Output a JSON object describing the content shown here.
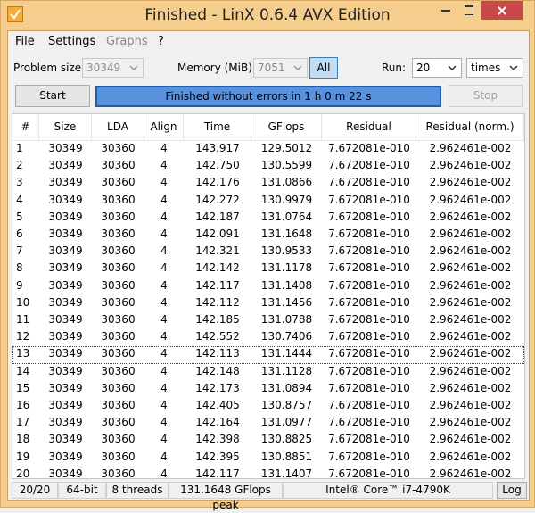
{
  "window": {
    "title": "Finished - LinX 0.6.4 AVX Edition",
    "icon": "checkmark-icon"
  },
  "menu": [
    "File",
    "Settings",
    "Graphs",
    "?"
  ],
  "controls": {
    "problem_size_label": "Problem size:",
    "problem_size_value": "30349",
    "memory_label": "Memory (MiB):",
    "memory_value": "7051",
    "all_label": "All",
    "run_label": "Run:",
    "run_value": "20",
    "times_value": "times",
    "start_label": "Start",
    "stop_label": "Stop",
    "status_text": "Finished without errors in 1 h 0 m 22 s",
    "progress": 1.0
  },
  "table": {
    "columns": [
      "#",
      "Size",
      "LDA",
      "Align",
      "Time",
      "GFlops",
      "Residual",
      "Residual (norm.)"
    ],
    "rows": [
      [
        "1",
        "30349",
        "30360",
        "4",
        "143.917",
        "129.5012",
        "7.672081e-010",
        "2.962461e-002"
      ],
      [
        "2",
        "30349",
        "30360",
        "4",
        "142.750",
        "130.5599",
        "7.672081e-010",
        "2.962461e-002"
      ],
      [
        "3",
        "30349",
        "30360",
        "4",
        "142.176",
        "131.0866",
        "7.672081e-010",
        "2.962461e-002"
      ],
      [
        "4",
        "30349",
        "30360",
        "4",
        "142.272",
        "130.9979",
        "7.672081e-010",
        "2.962461e-002"
      ],
      [
        "5",
        "30349",
        "30360",
        "4",
        "142.187",
        "131.0764",
        "7.672081e-010",
        "2.962461e-002"
      ],
      [
        "6",
        "30349",
        "30360",
        "4",
        "142.091",
        "131.1648",
        "7.672081e-010",
        "2.962461e-002"
      ],
      [
        "7",
        "30349",
        "30360",
        "4",
        "142.321",
        "130.9533",
        "7.672081e-010",
        "2.962461e-002"
      ],
      [
        "8",
        "30349",
        "30360",
        "4",
        "142.142",
        "131.1178",
        "7.672081e-010",
        "2.962461e-002"
      ],
      [
        "9",
        "30349",
        "30360",
        "4",
        "142.117",
        "131.1408",
        "7.672081e-010",
        "2.962461e-002"
      ],
      [
        "10",
        "30349",
        "30360",
        "4",
        "142.112",
        "131.1456",
        "7.672081e-010",
        "2.962461e-002"
      ],
      [
        "11",
        "30349",
        "30360",
        "4",
        "142.185",
        "131.0788",
        "7.672081e-010",
        "2.962461e-002"
      ],
      [
        "12",
        "30349",
        "30360",
        "4",
        "142.552",
        "130.7406",
        "7.672081e-010",
        "2.962461e-002"
      ],
      [
        "13",
        "30349",
        "30360",
        "4",
        "142.113",
        "131.1444",
        "7.672081e-010",
        "2.962461e-002"
      ],
      [
        "14",
        "30349",
        "30360",
        "4",
        "142.148",
        "131.1128",
        "7.672081e-010",
        "2.962461e-002"
      ],
      [
        "15",
        "30349",
        "30360",
        "4",
        "142.173",
        "131.0894",
        "7.672081e-010",
        "2.962461e-002"
      ],
      [
        "16",
        "30349",
        "30360",
        "4",
        "142.405",
        "130.8757",
        "7.672081e-010",
        "2.962461e-002"
      ],
      [
        "17",
        "30349",
        "30360",
        "4",
        "142.164",
        "131.0977",
        "7.672081e-010",
        "2.962461e-002"
      ],
      [
        "18",
        "30349",
        "30360",
        "4",
        "142.398",
        "130.8825",
        "7.672081e-010",
        "2.962461e-002"
      ],
      [
        "19",
        "30349",
        "30360",
        "4",
        "142.395",
        "130.8851",
        "7.672081e-010",
        "2.962461e-002"
      ],
      [
        "20",
        "30349",
        "30360",
        "4",
        "142.117",
        "131.1407",
        "7.672081e-010",
        "2.962461e-002"
      ]
    ],
    "selected_row": "13"
  },
  "statusbar": {
    "runs": "20/20",
    "bits": "64-bit",
    "threads": "8 threads",
    "peak": "131.1648 GFlops peak",
    "cpu": "Intel® Core™ i7-4790K",
    "log_label": "Log"
  },
  "colors": {
    "titlebar": "#f5ce8e",
    "close_button": "#c7494a",
    "progress": "#4f84d4"
  }
}
